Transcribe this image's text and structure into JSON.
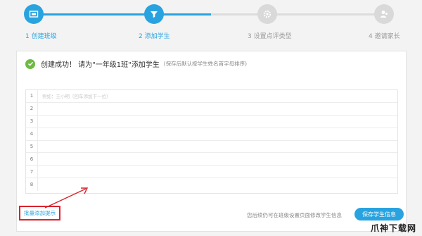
{
  "steps": [
    {
      "label": "1 创建班级",
      "state": "active",
      "icon": "class-board-icon"
    },
    {
      "label": "2 添加学生",
      "state": "active",
      "icon": "funnel-icon"
    },
    {
      "label": "3 设置点评类型",
      "state": "inactive",
      "icon": "gear-icon"
    },
    {
      "label": "4 邀请家长",
      "state": "inactive",
      "icon": "parent-icon"
    }
  ],
  "success": {
    "title": "创建成功！ 请为\"一年级1班\"添加学生",
    "note": "(保存后默认按学生姓名首字母排序)"
  },
  "grid": {
    "rows": [
      "1",
      "2",
      "3",
      "4",
      "5",
      "6",
      "7",
      "8"
    ],
    "placeholder": "例如：王小明（回车添加下一位）"
  },
  "footer": {
    "batch_link": "批量添加提示",
    "note": "您后续仍可在班级设置页面修改学生信息",
    "save_button": "保存学生信息"
  },
  "watermark": "爪神下载网",
  "colors": {
    "accent": "#29a3e0",
    "success": "#6dbb42",
    "highlight": "#d9232d"
  }
}
